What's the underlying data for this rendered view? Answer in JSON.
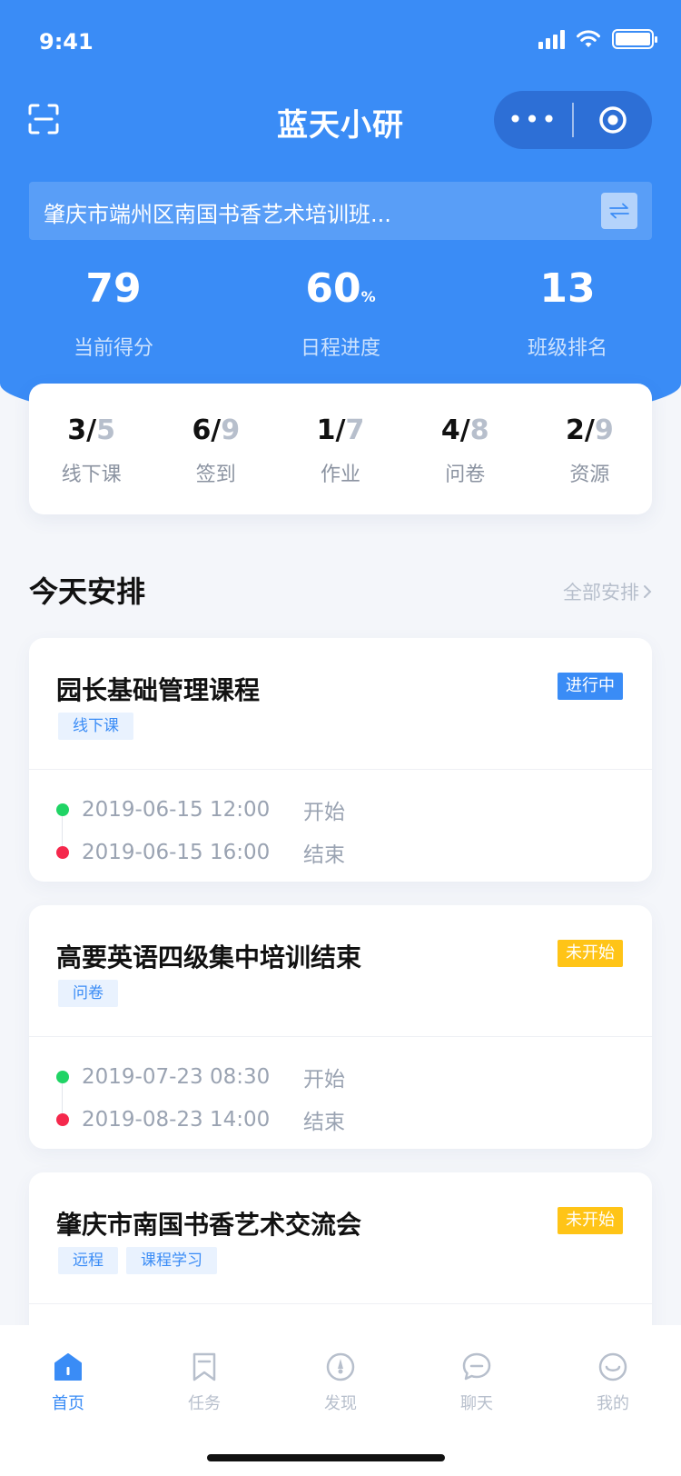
{
  "status": {
    "time": "9:41"
  },
  "nav": {
    "title": "蓝天小研",
    "more": "•••"
  },
  "org": {
    "name": "肇庆市端州区南国书香艺术培训班..."
  },
  "stats": [
    {
      "value": "79",
      "unit": "",
      "label": "当前得分"
    },
    {
      "value": "60",
      "unit": "%",
      "label": "日程进度"
    },
    {
      "value": "13",
      "unit": "",
      "label": "班级排名"
    }
  ],
  "progress": [
    {
      "done": "3/",
      "total": "5",
      "label": "线下课"
    },
    {
      "done": "6/",
      "total": "9",
      "label": "签到"
    },
    {
      "done": "1/",
      "total": "7",
      "label": "作业"
    },
    {
      "done": "4/",
      "total": "8",
      "label": "问卷"
    },
    {
      "done": "2/",
      "total": "9",
      "label": "资源"
    }
  ],
  "section": {
    "title": "今天安排",
    "link": "全部安排"
  },
  "cards": [
    {
      "title": "园长基础管理课程",
      "status": "进行中",
      "tags": [
        "线下课"
      ],
      "start": "2019-06-15 12:00",
      "start_label": "开始",
      "end": "2019-06-15 16:00",
      "end_label": "结束"
    },
    {
      "title": "高要英语四级集中培训结束",
      "status": "未开始",
      "tags": [
        "问卷"
      ],
      "start": "2019-07-23 08:30",
      "start_label": "开始",
      "end": "2019-08-23 14:00",
      "end_label": "结束"
    },
    {
      "title": "肇庆市南国书香艺术交流会",
      "status": "未开始",
      "tags": [
        "远程",
        "课程学习"
      ]
    }
  ],
  "tabbar": [
    {
      "label": "首页",
      "icon": "home-icon"
    },
    {
      "label": "任务",
      "icon": "bookmark-icon"
    },
    {
      "label": "发现",
      "icon": "compass-icon"
    },
    {
      "label": "聊天",
      "icon": "chat-icon"
    },
    {
      "label": "我的",
      "icon": "smile-icon"
    }
  ],
  "colors": {
    "primary": "#3a8cf6",
    "in_progress": "#3a8cf6",
    "not_started": "#ffc417",
    "start_dot": "#20d465",
    "end_dot": "#f5284c"
  }
}
